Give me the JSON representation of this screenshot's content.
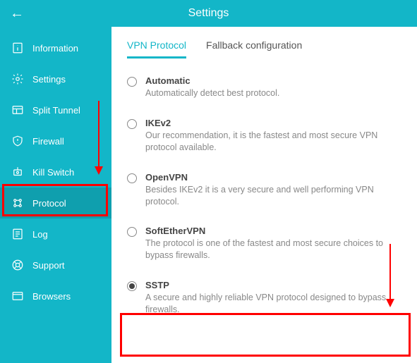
{
  "header": {
    "title": "Settings"
  },
  "sidebar": {
    "items": [
      {
        "label": "Information"
      },
      {
        "label": "Settings"
      },
      {
        "label": "Split Tunnel"
      },
      {
        "label": "Firewall"
      },
      {
        "label": "Kill Switch"
      },
      {
        "label": "Protocol"
      },
      {
        "label": "Log"
      },
      {
        "label": "Support"
      },
      {
        "label": "Browsers"
      }
    ]
  },
  "tabs": [
    {
      "label": "VPN Protocol"
    },
    {
      "label": "Fallback configuration"
    }
  ],
  "options": [
    {
      "title": "Automatic",
      "desc": "Automatically detect best protocol."
    },
    {
      "title": "IKEv2",
      "desc": "Our recommendation, it is the fastest and most secure VPN protocol available."
    },
    {
      "title": "OpenVPN",
      "desc": "Besides IKEv2 it is a very secure and well performing VPN protocol."
    },
    {
      "title": "SoftEtherVPN",
      "desc": "The protocol is one of the fastest and most secure choices to bypass firewalls."
    },
    {
      "title": "SSTP",
      "desc": "A secure and highly reliable VPN protocol designed to bypass firewalls."
    }
  ],
  "colors": {
    "accent": "#13b6c8",
    "annotation": "#ff0000"
  }
}
